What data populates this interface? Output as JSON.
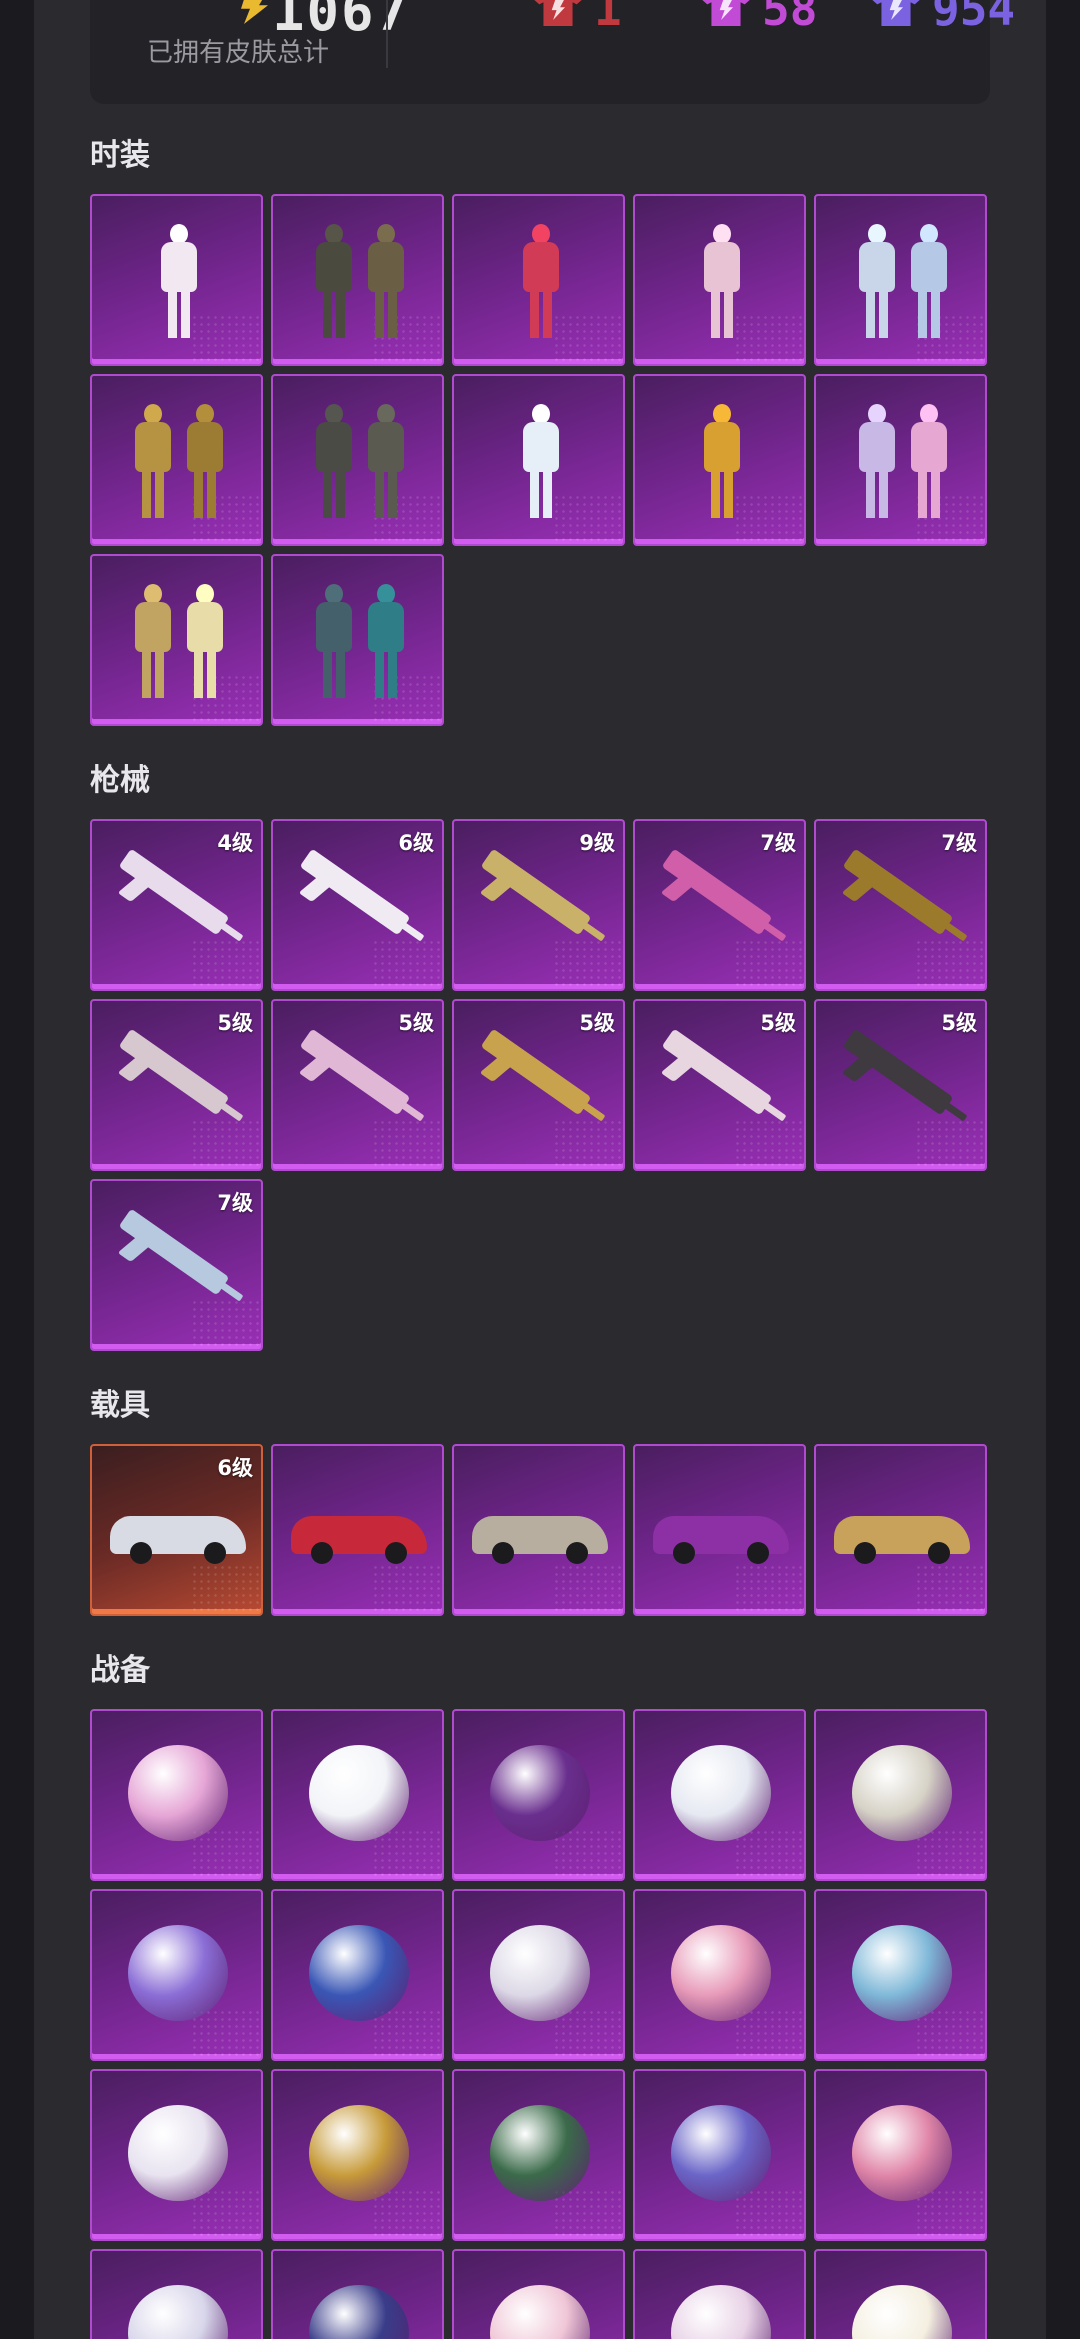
{
  "summary": {
    "total": "1067",
    "total_label": "已拥有皮肤总计",
    "stats": [
      {
        "value": "1",
        "color": "#c0393f"
      },
      {
        "value": "58",
        "color": "#c24bd6"
      },
      {
        "value": "954",
        "color": "#7b62e0"
      }
    ]
  },
  "sections": [
    {
      "title": "时装",
      "type": "outfit",
      "items": [
        {
          "colors": [
            "#f1e8f2"
          ],
          "count": 1
        },
        {
          "colors": [
            "#4b4a3e",
            "#6a5f44"
          ],
          "count": 2
        },
        {
          "colors": [
            "#d23b55"
          ],
          "count": 1
        },
        {
          "colors": [
            "#e7c3d3"
          ],
          "count": 1
        },
        {
          "colors": [
            "#c9d6ea",
            "#b5c9e6"
          ],
          "count": 2
        },
        {
          "colors": [
            "#b59342",
            "#9c7c33"
          ],
          "count": 2
        },
        {
          "colors": [
            "#4a4b45",
            "#5a5a51"
          ],
          "count": 2
        },
        {
          "colors": [
            "#e6eef8"
          ],
          "count": 1
        },
        {
          "colors": [
            "#d8a030"
          ],
          "count": 1
        },
        {
          "colors": [
            "#c8b8e6",
            "#e7a7d3"
          ],
          "count": 2
        },
        {
          "colors": [
            "#c1a462",
            "#e8dca8"
          ],
          "count": 2
        },
        {
          "colors": [
            "#44606a",
            "#2f7d86"
          ],
          "count": 2
        }
      ]
    },
    {
      "title": "枪械",
      "type": "gun",
      "items": [
        {
          "level": "4级",
          "color": "#e8dcec"
        },
        {
          "level": "6级",
          "color": "#f0eaf3"
        },
        {
          "level": "9级",
          "color": "#c9b16a"
        },
        {
          "level": "7级",
          "color": "#d05ea8"
        },
        {
          "level": "7级",
          "color": "#9b7b2b"
        },
        {
          "level": "5级",
          "color": "#d6c8ce"
        },
        {
          "level": "5级",
          "color": "#e0b8d6"
        },
        {
          "level": "5级",
          "color": "#c9a24d"
        },
        {
          "level": "5级",
          "color": "#e7d6e0"
        },
        {
          "level": "5级",
          "color": "#3e3a3f"
        },
        {
          "level": "7级",
          "color": "#b6c9de"
        }
      ]
    },
    {
      "title": "载具",
      "type": "vehicle",
      "items": [
        {
          "level": "6级",
          "color": "#d9dbe4",
          "highlight": true
        },
        {
          "level": "",
          "color": "#c7283a"
        },
        {
          "level": "",
          "color": "#b8aea0"
        },
        {
          "level": "",
          "color": "#8d2fa5"
        },
        {
          "level": "",
          "color": "#c8a15a"
        }
      ]
    },
    {
      "title": "战备",
      "type": "gear",
      "items": [
        {
          "color": "#e6a6d6"
        },
        {
          "color": "#f2f4f8"
        },
        {
          "color": "#6a2f8e"
        },
        {
          "color": "#e6e9f2"
        },
        {
          "color": "#d6d2c6"
        },
        {
          "color": "#8b6ed6"
        },
        {
          "color": "#3a57b5"
        },
        {
          "color": "#dcd8e6"
        },
        {
          "color": "#e79ab8"
        },
        {
          "color": "#7fb8d8"
        },
        {
          "color": "#e8e3f0"
        },
        {
          "color": "#c79b3a"
        },
        {
          "color": "#3b6b4a"
        },
        {
          "color": "#6b66c8"
        },
        {
          "color": "#e086a8"
        },
        {
          "color": "#d8d6ea"
        },
        {
          "color": "#3a3d8a"
        },
        {
          "color": "#f0c6d6"
        },
        {
          "color": "#e8d2e6"
        },
        {
          "color": "#f4efe0"
        }
      ]
    }
  ]
}
